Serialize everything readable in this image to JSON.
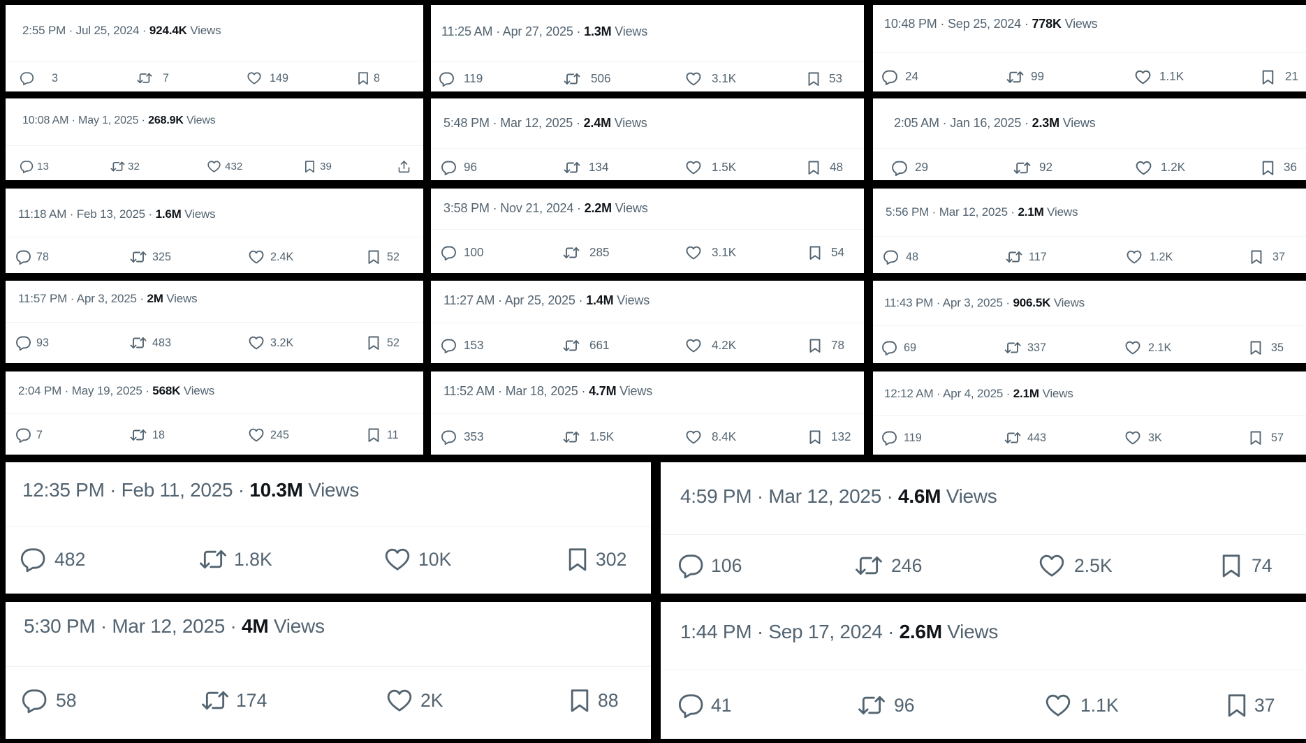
{
  "views_word": "Views",
  "posts": [
    {
      "time": "2:55 PM · Jul 25, 2024 · ",
      "views": "924.4K",
      "replies": "3",
      "reposts": "7",
      "likes": "149",
      "bookmarks": "8"
    },
    {
      "time": "11:25 AM · Apr 27, 2025 · ",
      "views": "1.3M",
      "replies": "119",
      "reposts": "506",
      "likes": "3.1K",
      "bookmarks": "53"
    },
    {
      "time": "10:48 PM · Sep 25, 2024 · ",
      "views": "778K",
      "replies": "24",
      "reposts": "99",
      "likes": "1.1K",
      "bookmarks": "21"
    },
    {
      "time": "10:08 AM · May 1, 2025 · ",
      "views": "268.9K",
      "replies": "13",
      "reposts": "32",
      "likes": "432",
      "bookmarks": "39",
      "share_icon": "share-icon"
    },
    {
      "time": "5:48 PM · Mar 12, 2025 · ",
      "views": "2.4M",
      "replies": "96",
      "reposts": "134",
      "likes": "1.5K",
      "bookmarks": "48"
    },
    {
      "time": "2:05 AM · Jan 16, 2025 · ",
      "views": "2.3M",
      "replies": "29",
      "reposts": "92",
      "likes": "1.2K",
      "bookmarks": "36"
    },
    {
      "time": "11:18 AM · Feb 13, 2025 · ",
      "views": "1.6M",
      "replies": "78",
      "reposts": "325",
      "likes": "2.4K",
      "bookmarks": "52"
    },
    {
      "time": "3:58 PM · Nov 21, 2024 · ",
      "views": "2.2M",
      "replies": "100",
      "reposts": "285",
      "likes": "3.1K",
      "bookmarks": "54"
    },
    {
      "time": "5:56 PM · Mar 12, 2025 · ",
      "views": "2.1M",
      "replies": "48",
      "reposts": "117",
      "likes": "1.2K",
      "bookmarks": "37"
    },
    {
      "time": "11:57 PM · Apr 3, 2025 · ",
      "views": "2M",
      "replies": "93",
      "reposts": "483",
      "likes": "3.2K",
      "bookmarks": "52"
    },
    {
      "time": "11:27 AM · Apr 25, 2025 · ",
      "views": "1.4M",
      "replies": "153",
      "reposts": "661",
      "likes": "4.2K",
      "bookmarks": "78"
    },
    {
      "time": "11:43 PM · Apr 3, 2025 · ",
      "views": "906.5K",
      "replies": "69",
      "reposts": "337",
      "likes": "2.1K",
      "bookmarks": "35"
    },
    {
      "time": "2:04 PM · May 19, 2025 · ",
      "views": "568K",
      "replies": "7",
      "reposts": "18",
      "likes": "245",
      "bookmarks": "11"
    },
    {
      "time": "11:52 AM · Mar 18, 2025 · ",
      "views": "4.7M",
      "replies": "353",
      "reposts": "1.5K",
      "likes": "8.4K",
      "bookmarks": "132"
    },
    {
      "time": "12:12 AM · Apr 4, 2025 · ",
      "views": "2.1M",
      "replies": "119",
      "reposts": "443",
      "likes": "3K",
      "bookmarks": "57"
    },
    {
      "time": "12:35 PM · Feb 11, 2025 · ",
      "views": "10.3M",
      "replies": "482",
      "reposts": "1.8K",
      "likes": "10K",
      "bookmarks": "302"
    },
    {
      "time": "4:59 PM · Mar 12, 2025 · ",
      "views": "4.6M",
      "replies": "106",
      "reposts": "246",
      "likes": "2.5K",
      "bookmarks": "74"
    },
    {
      "time": "5:30 PM · Mar 12, 2025 · ",
      "views": "4M",
      "replies": "58",
      "reposts": "174",
      "likes": "2K",
      "bookmarks": "88"
    },
    {
      "time": "1:44 PM · Sep 17, 2024 · ",
      "views": "2.6M",
      "replies": "41",
      "reposts": "96",
      "likes": "1.1K",
      "bookmarks": "37"
    }
  ],
  "icons": {
    "reply": "reply-icon",
    "repost": "repost-icon",
    "like": "like-icon",
    "bookmark": "bookmark-icon",
    "share": "share-icon"
  },
  "colors": {
    "text_secondary": "#536471",
    "text_primary": "#0f1419",
    "divider": "#eff3f4"
  }
}
